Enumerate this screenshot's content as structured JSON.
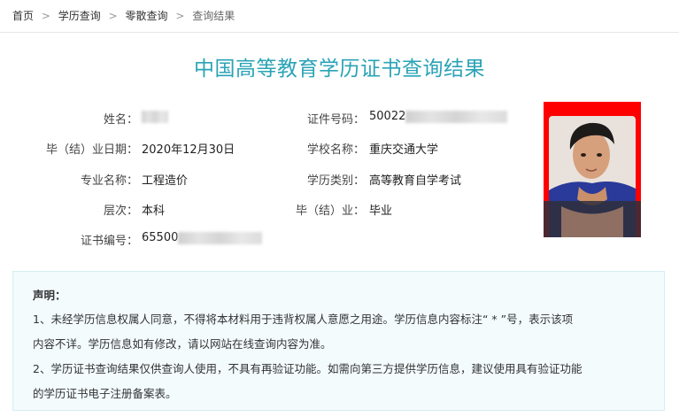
{
  "breadcrumb": {
    "home": "首页",
    "level1": "学历查询",
    "level2": "零散查询",
    "current": "查询结果",
    "separator": ">"
  },
  "title": "中国高等教育学历证书查询结果",
  "fields": {
    "name_label": "姓名：",
    "name_value": "",
    "id_label": "证件号码：",
    "id_value": "50022",
    "grad_date_label": "毕（结）业日期：",
    "grad_date_value": "2020年12月30日",
    "school_label": "学校名称：",
    "school_value": "重庆交通大学",
    "major_label": "专业名称：",
    "major_value": "工程造价",
    "category_label": "学历类别：",
    "category_value": "高等教育自学考试",
    "level_label": "层次：",
    "level_value": "本科",
    "status_label": "毕（结）业：",
    "status_value": "毕业",
    "cert_label": "证书编号：",
    "cert_value": "65500"
  },
  "photo": {
    "background": "#ff0000",
    "icon": "portrait-photo"
  },
  "notice": {
    "head": "声明：",
    "line1": "1、未经学历信息权属人同意，不得将本材料用于违背权属人意愿之用途。学历信息内容标注“ * ”号，表示该项",
    "line2": "内容不详。学历信息如有修改，请以网站在线查询内容为准。",
    "line3": "2、学历证书查询结果仅供查询人使用，不具有再验证功能。如需向第三方提供学历信息，建议使用具有验证功能",
    "line4": "的学历证书电子注册备案表。"
  },
  "colors": {
    "title": "#2aa3b6",
    "notice_bg": "#f3fbfd",
    "photo_bg": "#ff0000"
  }
}
